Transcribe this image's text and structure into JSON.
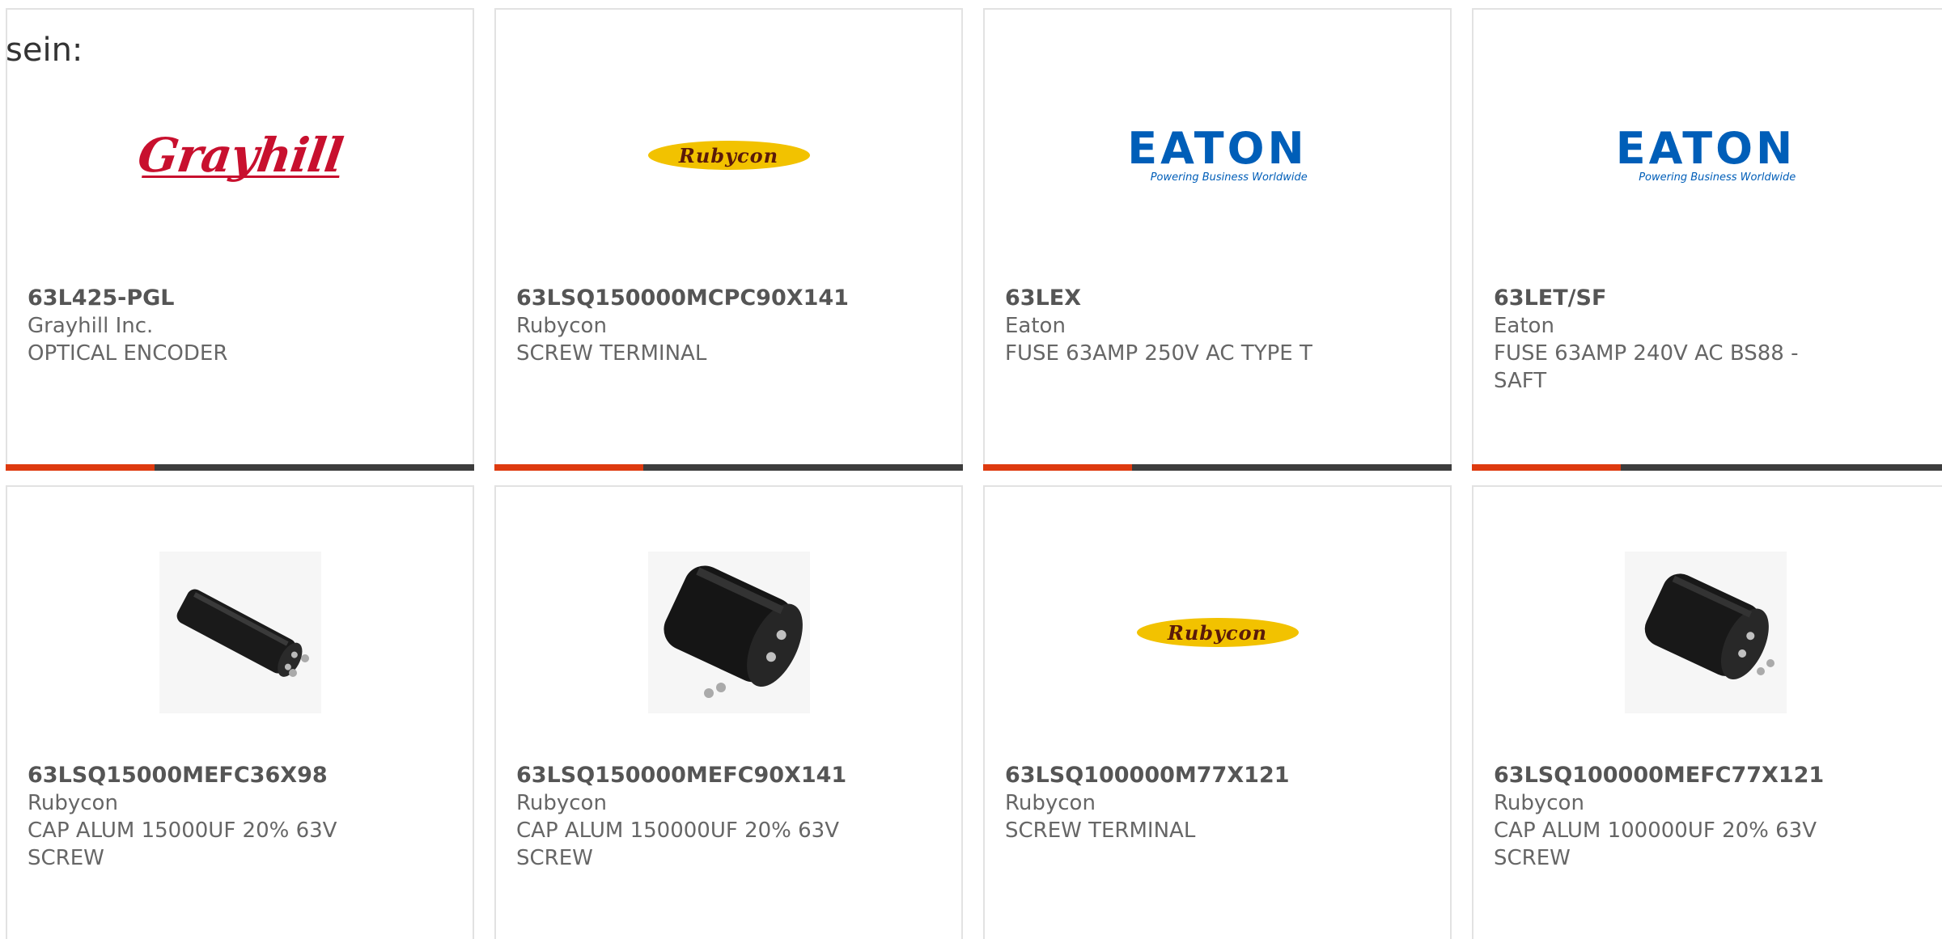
{
  "intro_text": "sein:",
  "colors": {
    "accent_bar": "#de3a0f",
    "dark_bar": "#3d3d3d",
    "eaton_blue": "#005eb8",
    "grayhill_red": "#c8102e",
    "rubycon_yellow": "#f2c200"
  },
  "products": [
    {
      "part_number": "63L425-PGL",
      "manufacturer": "Grayhill Inc.",
      "description": "OPTICAL ENCODER",
      "image": "grayhill-logo",
      "logo_text": "Grayhill"
    },
    {
      "part_number": "63LSQ150000MCPC90X141",
      "manufacturer": "Rubycon",
      "description": "SCREW TERMINAL",
      "image": "rubycon-logo",
      "logo_text": "Rubycon"
    },
    {
      "part_number": "63LEX",
      "manufacturer": "Eaton",
      "description": "FUSE 63AMP 250V AC TYPE T",
      "image": "eaton-logo",
      "logo_text": "EATON",
      "logo_tagline": "Powering Business Worldwide"
    },
    {
      "part_number": "63LET/SF",
      "manufacturer": "Eaton",
      "description": "FUSE 63AMP 240V AC BS88 - SAFT",
      "image": "eaton-logo",
      "logo_text": "EATON",
      "logo_tagline": "Powering Business Worldwide"
    },
    {
      "part_number": "63LSQ15000MEFC36X98",
      "manufacturer": "Rubycon",
      "description": "CAP ALUM 15000UF 20% 63V SCREW",
      "image": "capacitor-slim-photo"
    },
    {
      "part_number": "63LSQ150000MEFC90X141",
      "manufacturer": "Rubycon",
      "description": "CAP ALUM 150000UF 20% 63V SCREW",
      "image": "capacitor-large-photo"
    },
    {
      "part_number": "63LSQ100000M77X121",
      "manufacturer": "Rubycon",
      "description": "SCREW TERMINAL",
      "image": "rubycon-logo",
      "logo_text": "Rubycon"
    },
    {
      "part_number": "63LSQ100000MEFC77X121",
      "manufacturer": "Rubycon",
      "description": "CAP ALUM 100000UF 20% 63V SCREW",
      "image": "capacitor-medium-photo"
    }
  ]
}
